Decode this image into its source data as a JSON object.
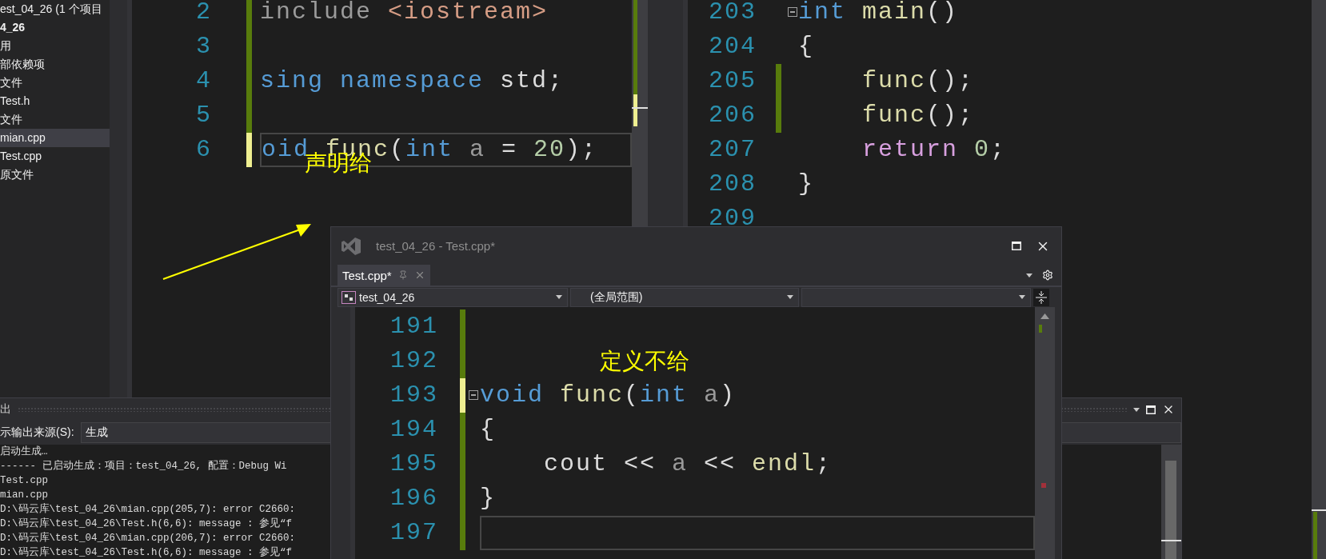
{
  "solution_explorer": {
    "items": [
      {
        "label": "est_04_26 (1 个项目",
        "kind": "solution",
        "selected": false
      },
      {
        "label": "4_26",
        "kind": "project",
        "selected": false
      },
      {
        "label": "用",
        "kind": "folder",
        "selected": false
      },
      {
        "label": "部依赖项",
        "kind": "folder",
        "selected": false
      },
      {
        "label": "文件",
        "kind": "folder",
        "selected": false
      },
      {
        "label": "Test.h",
        "kind": "file",
        "selected": false
      },
      {
        "label": "文件",
        "kind": "folder",
        "selected": false
      },
      {
        "label": "mian.cpp",
        "kind": "file",
        "selected": true
      },
      {
        "label": "Test.cpp",
        "kind": "file",
        "selected": false
      },
      {
        "label": "原文件",
        "kind": "folder",
        "selected": false
      }
    ]
  },
  "left_editor": {
    "lines": [
      {
        "number": "2",
        "color": "#587c0c",
        "current": false,
        "tokens": [
          {
            "text": "include ",
            "kind": "preprocessor"
          },
          {
            "text": "<iostream>",
            "kind": "string"
          }
        ]
      },
      {
        "number": "3",
        "color": "#587c0c",
        "current": false
      },
      {
        "number": "4",
        "color": "#587c0c",
        "current": false,
        "tokens": [
          {
            "text": "sing namespace",
            "kind": "keyword"
          },
          {
            "text": " std;",
            "kind": "plain"
          }
        ]
      },
      {
        "number": "5",
        "color": "#587c0c",
        "current": false
      },
      {
        "number": "6",
        "color": "#efef91",
        "current": true,
        "tokens": [
          {
            "text": "oid",
            "kind": "keyword"
          },
          {
            "text": " func",
            "kind": "function"
          },
          {
            "text": "(",
            "kind": "plain"
          },
          {
            "text": "int",
            "kind": "keyword"
          },
          {
            "text": " a",
            "kind": "param"
          },
          {
            "text": " = ",
            "kind": "plain"
          },
          {
            "text": "20",
            "kind": "number"
          },
          {
            "text": ");",
            "kind": "plain"
          }
        ]
      }
    ]
  },
  "right_editor": {
    "lines": [
      {
        "number": "203",
        "current": false,
        "fold": true,
        "tokens": [
          {
            "text": "int",
            "kind": "keyword"
          },
          {
            "text": " main",
            "kind": "function"
          },
          {
            "text": "()",
            "kind": "plain"
          }
        ]
      },
      {
        "number": "204",
        "current": false,
        "fold": false,
        "tokens": [
          {
            "text": "{",
            "kind": "plain"
          }
        ]
      },
      {
        "number": "205",
        "color": "#587c0c",
        "current": false,
        "fold": false,
        "tokens": [
          {
            "text": "    func",
            "kind": "function"
          },
          {
            "text": "();",
            "kind": "plain"
          }
        ]
      },
      {
        "number": "206",
        "color": "#587c0c",
        "current": false,
        "fold": false,
        "tokens": [
          {
            "text": "    func",
            "kind": "function"
          },
          {
            "text": "();",
            "kind": "plain"
          }
        ]
      },
      {
        "number": "207",
        "current": false,
        "fold": false,
        "tokens": [
          {
            "text": "    return",
            "kind": "control"
          },
          {
            "text": " 0",
            "kind": "number"
          },
          {
            "text": ";",
            "kind": "plain"
          }
        ]
      },
      {
        "number": "208",
        "current": false,
        "fold": false,
        "tokens": [
          {
            "text": "}",
            "kind": "plain"
          }
        ]
      },
      {
        "number": "209",
        "current": false,
        "fold": false
      }
    ]
  },
  "output_panel": {
    "title": "出",
    "source_label": "示输出来源(S):",
    "source_value": "生成",
    "lines": [
      "启动生成…",
      "------ 已启动生成：项目：test_04_26, 配置：Debug Wi",
      "Test.cpp",
      "mian.cpp",
      "D:\\码云库\\test_04_26\\mian.cpp(205,7): error C2660:",
      "D:\\码云库\\test_04_26\\Test.h(6,6): message : 参见“f",
      "D:\\码云库\\test_04_26\\mian.cpp(206,7): error C2660:",
      "D:\\码云库\\test_04_26\\Test.h(6,6): message : 参见“f"
    ]
  },
  "floating_window": {
    "title": "test_04_26 - Test.cpp*",
    "tabs": [
      {
        "label": "Test.cpp*",
        "selected": true
      }
    ],
    "nav": [
      {
        "value": "test_04_26",
        "kind": "project"
      },
      {
        "value": "(全局范围)",
        "kind": "scope"
      },
      {
        "kind": "member"
      }
    ],
    "lines": [
      {
        "number": "191",
        "color": "#587c0c",
        "current": false,
        "fold": false
      },
      {
        "number": "192",
        "color": "#587c0c",
        "current": false,
        "fold": false
      },
      {
        "number": "193",
        "color": "#efef91",
        "current": false,
        "fold": true,
        "tokens": [
          {
            "text": "void",
            "kind": "keyword"
          },
          {
            "text": " func",
            "kind": "function"
          },
          {
            "text": "(",
            "kind": "plain"
          },
          {
            "text": "int",
            "kind": "keyword"
          },
          {
            "text": " a",
            "kind": "param"
          },
          {
            "text": ")",
            "kind": "plain"
          }
        ]
      },
      {
        "number": "194",
        "color": "#587c0c",
        "current": false,
        "fold": false,
        "tokens": [
          {
            "text": "{",
            "kind": "plain"
          }
        ]
      },
      {
        "number": "195",
        "color": "#587c0c",
        "current": false,
        "fold": false,
        "tokens": [
          {
            "text": "    cout << ",
            "kind": "plain"
          },
          {
            "text": "a",
            "kind": "param"
          },
          {
            "text": " << ",
            "kind": "plain"
          },
          {
            "text": "endl",
            "kind": "function"
          },
          {
            "text": ";",
            "kind": "plain"
          }
        ]
      },
      {
        "number": "196",
        "color": "#587c0c",
        "current": false,
        "fold": false,
        "tokens": [
          {
            "text": "}",
            "kind": "plain"
          }
        ]
      },
      {
        "number": "197",
        "color": "#587c0c",
        "current": true,
        "fold": false
      }
    ]
  },
  "annotations": [
    {
      "text": "声明给"
    },
    {
      "text": "定义不给"
    }
  ]
}
